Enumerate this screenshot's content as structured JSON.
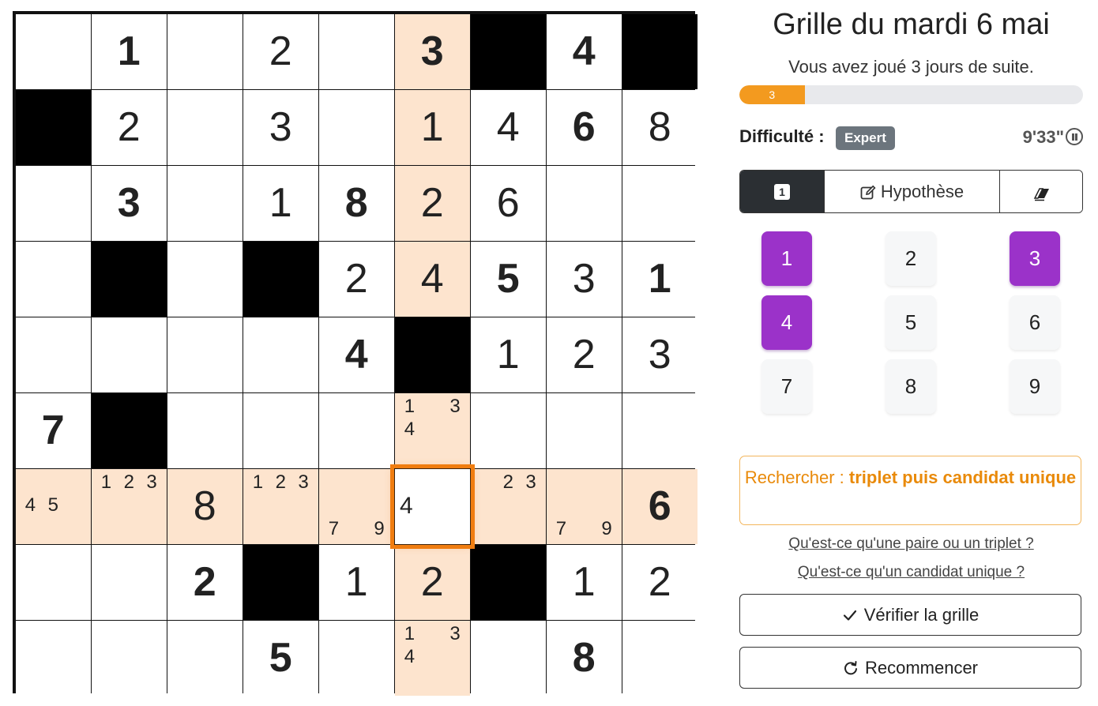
{
  "header": {
    "title": "Grille du mardi 6 mai",
    "streak_text": "Vous avez joué 3 jours de suite.",
    "streak_progress_label": "3",
    "streak_progress_fraction": 0.19
  },
  "difficulty": {
    "label": "Difficulté :",
    "level": "Expert"
  },
  "timer": {
    "value": "9'33\""
  },
  "modes": {
    "number_label": "1",
    "hypothesis_label": "Hypothèse",
    "active": "number"
  },
  "numpad": [
    {
      "label": "1",
      "used": true
    },
    {
      "label": "2",
      "used": false
    },
    {
      "label": "3",
      "used": true
    },
    {
      "label": "4",
      "used": true
    },
    {
      "label": "5",
      "used": false
    },
    {
      "label": "6",
      "used": false
    },
    {
      "label": "7",
      "used": false
    },
    {
      "label": "8",
      "used": false
    },
    {
      "label": "9",
      "used": false
    }
  ],
  "hint": {
    "prefix": "Rechercher : ",
    "technique": "triplet puis candidat unique"
  },
  "links": {
    "pair_triplet": "Qu'est-ce qu'une paire ou un triplet ?",
    "single_candidate": "Qu'est-ce qu'un candidat unique ?"
  },
  "buttons": {
    "verify": "Vérifier la grille",
    "restart": "Recommencer"
  },
  "board": {
    "selected": [
      6,
      5
    ],
    "highlighted_row": 6,
    "highlighted_col": 5,
    "cells": [
      [
        {
          "v": ""
        },
        {
          "v": "1",
          "g": true
        },
        {
          "v": ""
        },
        {
          "v": "2"
        },
        {
          "v": ""
        },
        {
          "v": "3",
          "g": true
        },
        {
          "b": true
        },
        {
          "v": "4",
          "g": true
        },
        {
          "b": true
        }
      ],
      [
        {
          "b": true
        },
        {
          "v": "2"
        },
        {
          "v": ""
        },
        {
          "v": "3"
        },
        {
          "v": ""
        },
        {
          "v": "1"
        },
        {
          "v": "4"
        },
        {
          "v": "6",
          "g": true
        },
        {
          "v": "8"
        }
      ],
      [
        {
          "v": ""
        },
        {
          "v": "3",
          "g": true
        },
        {
          "v": ""
        },
        {
          "v": "1"
        },
        {
          "v": "8",
          "g": true
        },
        {
          "v": "2"
        },
        {
          "v": "6"
        },
        {
          "v": ""
        },
        {
          "v": ""
        }
      ],
      [
        {
          "v": ""
        },
        {
          "b": true
        },
        {
          "v": ""
        },
        {
          "b": true
        },
        {
          "v": "2"
        },
        {
          "v": "4"
        },
        {
          "v": "5",
          "g": true
        },
        {
          "v": "3"
        },
        {
          "v": "1",
          "g": true
        }
      ],
      [
        {
          "v": ""
        },
        {
          "v": ""
        },
        {
          "v": ""
        },
        {
          "v": ""
        },
        {
          "v": "4",
          "g": true
        },
        {
          "b": true
        },
        {
          "v": "1"
        },
        {
          "v": "2"
        },
        {
          "v": "3"
        }
      ],
      [
        {
          "v": "7",
          "g": true
        },
        {
          "b": true
        },
        {
          "v": ""
        },
        {
          "v": ""
        },
        {
          "v": ""
        },
        {
          "n": [
            "1",
            "",
            "3",
            "4",
            "",
            "",
            "",
            "",
            ""
          ]
        },
        {
          "v": ""
        },
        {
          "v": ""
        },
        {
          "v": ""
        }
      ],
      [
        {
          "n": [
            "",
            "",
            "",
            "4",
            "5",
            "",
            "",
            "",
            ""
          ]
        },
        {
          "n": [
            "1",
            "2",
            "3",
            "",
            "",
            "",
            "",
            "",
            ""
          ]
        },
        {
          "v": "8"
        },
        {
          "n": [
            "1",
            "2",
            "3",
            "",
            "",
            "",
            "",
            "",
            ""
          ]
        },
        {
          "n": [
            "",
            "",
            "",
            "",
            "",
            "",
            "7",
            "",
            "9"
          ]
        },
        {
          "v": "4"
        },
        {
          "n": [
            "",
            "2",
            "3",
            "",
            "",
            "",
            "",
            "",
            ""
          ]
        },
        {
          "n": [
            "",
            "",
            "",
            "",
            "",
            "",
            "7",
            "",
            "9"
          ]
        },
        {
          "v": "6",
          "g": true
        }
      ],
      [
        {
          "v": ""
        },
        {
          "v": ""
        },
        {
          "v": "2",
          "g": true
        },
        {
          "b": true
        },
        {
          "v": "1"
        },
        {
          "v": "2"
        },
        {
          "b": true
        },
        {
          "v": "1"
        },
        {
          "v": "2"
        }
      ],
      [
        {
          "v": ""
        },
        {
          "v": ""
        },
        {
          "v": ""
        },
        {
          "v": "5",
          "g": true
        },
        {
          "v": ""
        },
        {
          "n": [
            "1",
            "",
            "3",
            "4",
            "",
            "",
            "",
            "",
            ""
          ]
        },
        {
          "v": ""
        },
        {
          "v": "8",
          "g": true
        },
        {
          "v": ""
        }
      ]
    ]
  },
  "icon_names": {
    "mode_number": "number-mode-icon",
    "mode_hypothesis": "pencil-square-icon",
    "mode_erase": "eraser-icon",
    "pause": "pause-circle-icon",
    "verify": "check-icon",
    "restart": "rotate-icon"
  },
  "colors": {
    "accent_orange": "#f07d10",
    "highlight": "#fde4ce",
    "used_purple": "#9b32c9",
    "progress_fill": "#f39a1f",
    "badge_grey": "#6c757d"
  }
}
